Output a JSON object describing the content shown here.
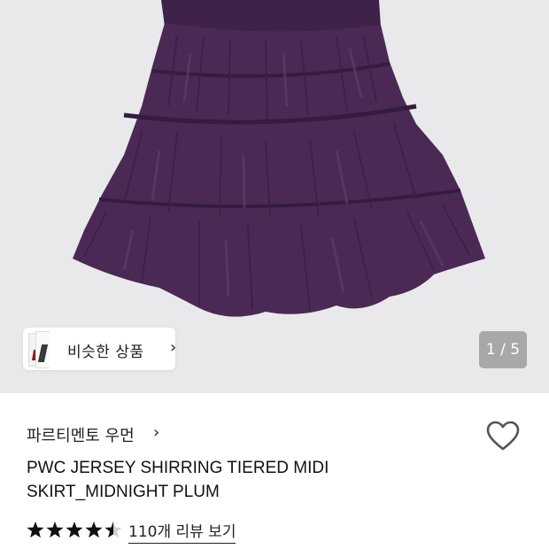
{
  "product_image": {
    "alt": "PWC JERSEY SHIRRING TIERED MIDI SKIRT_MIDNIGHT PLUM",
    "colors": {
      "background": "#e9e9eb",
      "fabric": "#4a2a55",
      "fabric_dark": "#351c3f",
      "fabric_light": "#5a3768"
    }
  },
  "similar_products": {
    "label": "비슷한 상품",
    "chevron": "›"
  },
  "image_counter": {
    "current": 1,
    "total": 5,
    "text": "1 / 5"
  },
  "product": {
    "brand": "파르티멘토 우먼",
    "brand_chevron": "›",
    "title": "PWC JERSEY SHIRRING TIERED MIDI SKIRT_MIDNIGHT PLUM",
    "rating": 4.5,
    "rating_max": 5,
    "review_link": "110개 리뷰 보기"
  },
  "icons": {
    "wishlist": "heart-outline-icon",
    "star": "star-icon"
  }
}
